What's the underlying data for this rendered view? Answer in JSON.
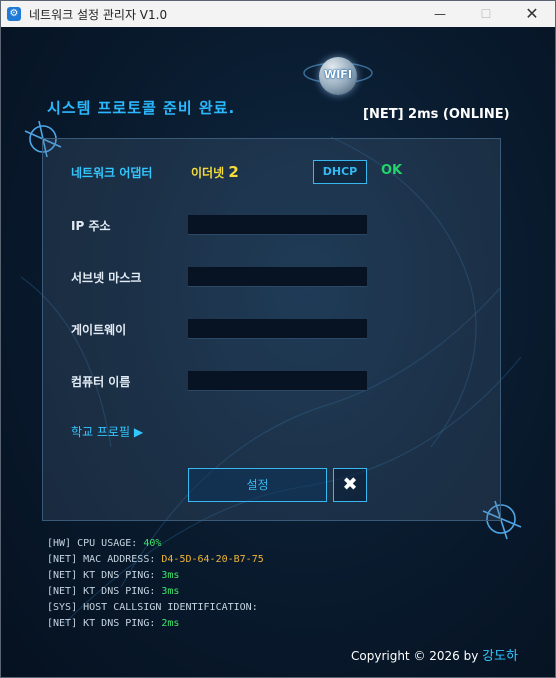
{
  "window": {
    "title": "네트워크 설정 관리자 V1.0",
    "min_glyph": "—",
    "max_glyph": "☐",
    "close_glyph": "✕",
    "app_icon": "gear-icon"
  },
  "header": {
    "status_message": "시스템 프로토콜 준비 완료.",
    "net_status": "[NET] 2ms (ONLINE)",
    "wifi_badge": "WIFI"
  },
  "panel": {
    "adapter_label": "네트워크 어댑터",
    "adapter_value_text": "이더넷",
    "adapter_value_num": "2",
    "dhcp_label": "DHCP",
    "ok_label": "OK",
    "fields": [
      {
        "label": "IP 주소",
        "value": ""
      },
      {
        "label": "서브넷 마스크",
        "value": ""
      },
      {
        "label": "게이트웨이",
        "value": ""
      },
      {
        "label": "컴퓨터 이름",
        "value": ""
      }
    ],
    "school_profile_link": "학교 프로필 ▶",
    "set_button": "설정",
    "close_button": "✖"
  },
  "log": [
    {
      "prefix": "[HW] CPU USAGE: ",
      "value": "40%",
      "color": "#3ee36a"
    },
    {
      "prefix": "[NET] MAC ADDRESS: ",
      "value": "D4-5D-64-20-B7-75",
      "color": "#f0b537"
    },
    {
      "prefix": "[NET] KT DNS PING: ",
      "value": "3ms",
      "color": "#3ee36a"
    },
    {
      "prefix": "[NET] KT DNS PING: ",
      "value": "3ms",
      "color": "#3ee36a"
    },
    {
      "prefix": "[SYS] HOST CALLSIGN IDENTIFICATION:",
      "value": "",
      "color": "#c5d3e0"
    },
    {
      "prefix": "[NET] KT DNS PING: ",
      "value": "2ms",
      "color": "#3ee36a"
    }
  ],
  "footer": {
    "copyright": "Copyright © 2026 by",
    "author": "강도하"
  },
  "colors": {
    "accent": "#33c6ff",
    "ok": "#23d46a",
    "adapter_value": "#f5dc3b"
  }
}
